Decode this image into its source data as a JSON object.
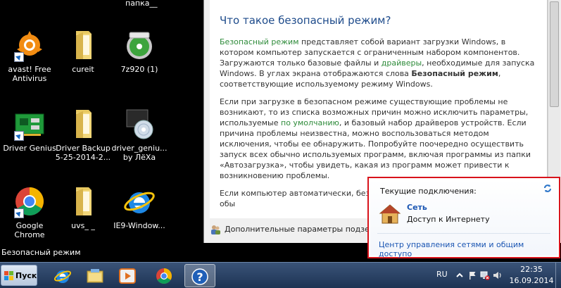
{
  "desktop": {
    "top_label": "папка__",
    "safe_mode_label": "Безопасный режим",
    "icons": [
      {
        "label": "avast! Free Antivirus"
      },
      {
        "label": "cureit"
      },
      {
        "label": "7z920 (1)"
      },
      {
        "label": "Driver Genius"
      },
      {
        "label": "Driver Backup 5-25-2014-2..."
      },
      {
        "label": "driver_geniu... by ЛёХа"
      },
      {
        "label": "Google Chrome"
      },
      {
        "label": "uvs_ _"
      },
      {
        "label": "IE9-Window..."
      }
    ]
  },
  "help": {
    "title": "Что такое безопасный режим?",
    "p1": {
      "a": "Безопасный режим",
      "b": " представляет собой вариант загрузки Windows, в котором компьютер запускается с ограниченным набором компонентов. Загружаются только базовые файлы и ",
      "c": "драйверы",
      "d": ", необходимые для запуска Windows. В углах экрана отображаются слова ",
      "e": "Безопасный режим",
      "f": ", соответствующие используемому режиму Windows."
    },
    "p2": {
      "a": "Если при загрузке в безопасном режиме существующие проблемы не возникают, то из списка возможных причин можно исключить параметры, используемые ",
      "b": "по умолчанию",
      "c": ", и базовый набор драйверов устройств. Если причина проблемы неизвестна, можно воспользоваться методом исключения, чтобы ее обнаружить. Попробуйте поочередно осуществить запуск всех обычно используемых программ, включая программы из папки «Автозагрузка», чтобы увидеть, какая из программ может привести к возникновению проблемы."
    },
    "p3": "Если компьютер автоматически, без за возможно, проблема препятствует обы",
    "footer": "Дополнительные параметры подзер"
  },
  "network": {
    "title": "Текущие подключения:",
    "name": "Сеть",
    "status": "Доступ к Интернету",
    "link": "Центр управления сетями и общим доступо"
  },
  "taskbar": {
    "start": "Пуск",
    "lang": "RU",
    "time": "22:35",
    "date": "16.09.2014"
  }
}
